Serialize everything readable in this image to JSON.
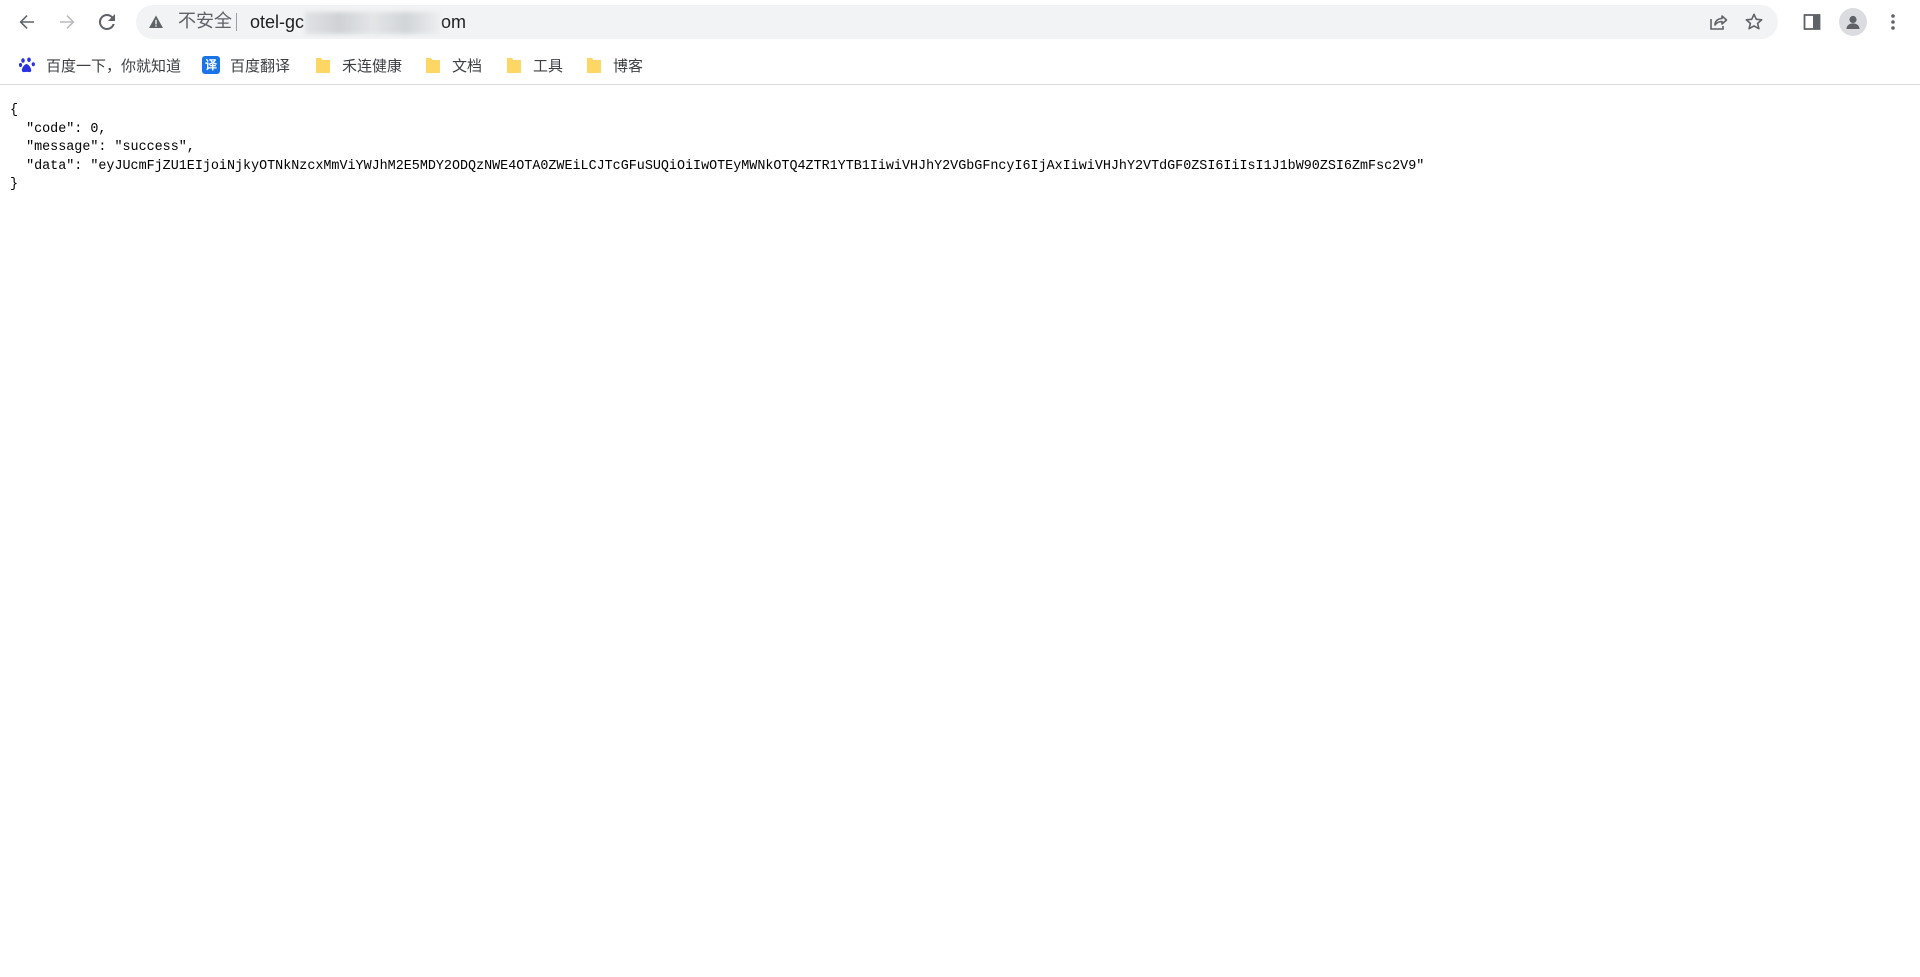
{
  "toolbar": {
    "security_label": "不安全",
    "url_start": "otel-gc",
    "url_end": "om",
    "icons": {
      "back": "back-arrow-icon",
      "forward": "forward-arrow-icon",
      "reload": "reload-icon",
      "warning": "warning-triangle-icon",
      "share": "share-icon",
      "bookmark_star": "star-icon",
      "side_panel": "side-panel-icon",
      "profile": "profile-avatar-icon",
      "menu": "kebab-menu-icon"
    }
  },
  "bookmarks": {
    "items": [
      {
        "label": "百度一下，你就知道",
        "icon": "baidu-paw-icon"
      },
      {
        "label": "百度翻译",
        "icon": "translate-icon",
        "icon_text": "译"
      },
      {
        "label": "禾连健康",
        "icon": "folder-icon"
      },
      {
        "label": "文档",
        "icon": "folder-icon"
      },
      {
        "label": "工具",
        "icon": "folder-icon"
      },
      {
        "label": "博客",
        "icon": "folder-icon"
      }
    ]
  },
  "json_response": {
    "open_brace": "{",
    "line_code": "  \"code\": 0,",
    "line_message": "  \"message\": \"success\",",
    "line_data": "  \"data\": \"eyJUcmFjZU1EIjoiNjkyOTNkNzcxMmViYWJhM2E5MDY2ODQzNWE4OTA0ZWEiLCJTcGFuSUQiOiIwOTEyMWNkOTQ4ZTR1YTB1IiwiVHJhY2VGbGFncyI6IjAxIiwiVHJhY2VTdGF0ZSI6IiIsI1J1bW90ZSI6ZmFsc2V9\"",
    "close_brace": "}"
  },
  "colors": {
    "omnibox_bg": "#f1f3f4",
    "icon_gray": "#5f6368",
    "folder_yellow": "#fdd663",
    "translate_blue": "#1a73e8",
    "baidu_blue": "#2932e1"
  }
}
